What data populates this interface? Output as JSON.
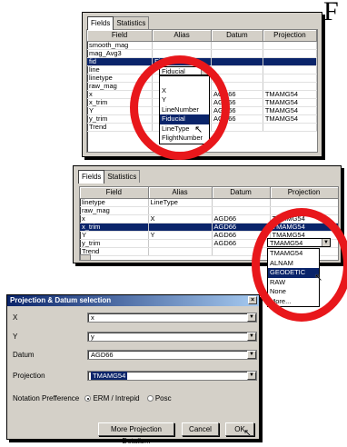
{
  "corner_letter": "F",
  "panel1": {
    "tabs": [
      "Fields",
      "Statistics"
    ],
    "columns": [
      "Field",
      "Alias",
      "Datum",
      "Projection"
    ],
    "rows": [
      {
        "field": "smooth_mag",
        "alias": "",
        "datum": "",
        "projection": ""
      },
      {
        "field": "mag_Avg3",
        "alias": "",
        "datum": "",
        "projection": ""
      },
      {
        "field": "fid",
        "alias": "Fiducial",
        "datum": "",
        "projection": "",
        "selected": true
      },
      {
        "field": "line",
        "alias": "",
        "datum": "",
        "projection": ""
      },
      {
        "field": "linetype",
        "alias": "",
        "datum": "",
        "projection": ""
      },
      {
        "field": "raw_mag",
        "alias": "",
        "datum": "",
        "projection": ""
      },
      {
        "field": "x",
        "alias": "",
        "datum": "AGD66",
        "projection": "TMAMG54"
      },
      {
        "field": "x_trim",
        "alias": "",
        "datum": "AGD66",
        "projection": "TMAMG54"
      },
      {
        "field": "Y",
        "alias": "",
        "datum": "AGD66",
        "projection": "TMAMG54"
      },
      {
        "field": "y_trim",
        "alias": "",
        "datum": "AGD66",
        "projection": "TMAMG54"
      },
      {
        "field": "Trend",
        "alias": "",
        "datum": "",
        "projection": ""
      }
    ],
    "alias_dropdown": {
      "value": "Fiducial",
      "options": [
        "",
        "X",
        "Y",
        "LineNumber",
        "Fiducial",
        "LineType",
        "FlightNumber"
      ],
      "highlighted": "Fiducial"
    }
  },
  "panel2": {
    "tabs": [
      "Fields",
      "Statistics"
    ],
    "columns": [
      "Field",
      "Alias",
      "Datum",
      "Projection"
    ],
    "rows": [
      {
        "field": "linetype",
        "alias": "LineType",
        "datum": "",
        "projection": ""
      },
      {
        "field": "raw_mag",
        "alias": "",
        "datum": "",
        "projection": ""
      },
      {
        "field": "x",
        "alias": "X",
        "datum": "AGD66",
        "projection": "TMAMG54"
      },
      {
        "field": "x_trim",
        "alias": "",
        "datum": "AGD66",
        "projection": "TMAMG54",
        "selected": true
      },
      {
        "field": "Y",
        "alias": "Y",
        "datum": "AGD66",
        "projection": "TMAMG54"
      },
      {
        "field": "y_trim",
        "alias": "",
        "datum": "AGD66",
        "projection": ""
      },
      {
        "field": "Trend",
        "alias": "",
        "datum": "",
        "projection": ""
      }
    ],
    "projection_dropdown": {
      "value": "TMAMG54",
      "options": [
        "TMAMG54",
        "ALNAM",
        "GEODETIC",
        "RAW",
        "None",
        "More..."
      ],
      "highlighted": "GEODETIC"
    }
  },
  "dialog": {
    "title": "Projection & Datum selection",
    "close_glyph": "×",
    "x_label": "X",
    "x_value": "x",
    "y_label": "Y",
    "y_value": "y",
    "datum_label": "Datum",
    "datum_value": "AGD66",
    "projection_label": "Projection",
    "projection_value": "TMAMG54",
    "notation_label": "Notation Prefference",
    "notation_options": [
      "ERM / Intrepid",
      "Posc"
    ],
    "notation_selected": "ERM / Intrepid",
    "more_button": "More Projection Details...",
    "cancel_button": "Cancel",
    "ok_button": "OK"
  },
  "colors": {
    "ring": "#e8171b",
    "selection": "#0a246a",
    "window": "#d4d0c8"
  },
  "icons": {
    "dropdown_arrow": "▼",
    "cursor": "arrow-cursor"
  }
}
